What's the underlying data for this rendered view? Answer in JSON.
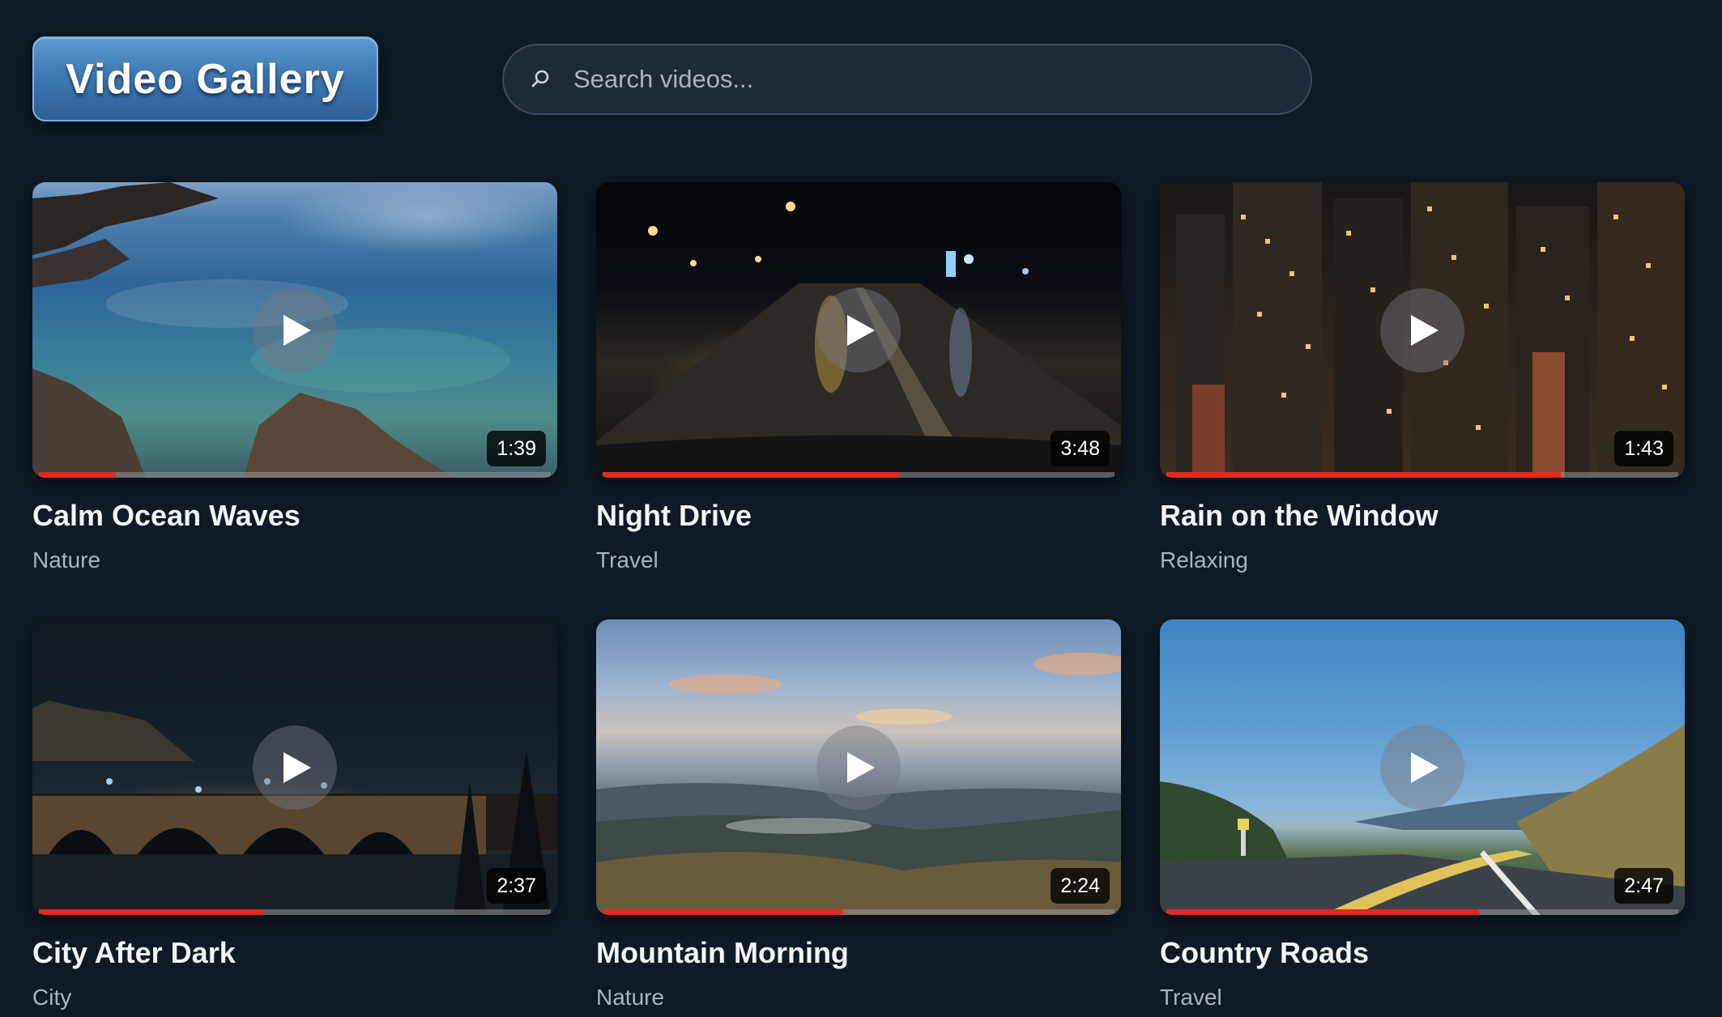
{
  "header": {
    "title": "Video Gallery",
    "search_placeholder": "Search videos..."
  },
  "videos": [
    {
      "title": "Calm Ocean Waves",
      "category": "Nature",
      "duration": "1:39",
      "progress": 0.15,
      "scene": "ocean"
    },
    {
      "title": "Night Drive",
      "category": "Travel",
      "duration": "3:48",
      "progress": 0.58,
      "scene": "night-road"
    },
    {
      "title": "Rain on the Window",
      "category": "Relaxing",
      "duration": "1:43",
      "progress": 0.77,
      "scene": "city-towers"
    },
    {
      "title": "City After Dark",
      "category": "City",
      "duration": "2:37",
      "progress": 0.44,
      "scene": "bridge-night"
    },
    {
      "title": "Mountain Morning",
      "category": "Nature",
      "duration": "2:24",
      "progress": 0.47,
      "scene": "mountains"
    },
    {
      "title": "Country Roads",
      "category": "Travel",
      "duration": "2:47",
      "progress": 0.61,
      "scene": "country-road"
    }
  ],
  "colors": {
    "background": "#0f1a26",
    "accent": "#3a73ae",
    "progress": "#e02a20",
    "muted_text": "#a9b4c1"
  },
  "icons": {
    "search": "search-icon",
    "play": "play-icon"
  }
}
